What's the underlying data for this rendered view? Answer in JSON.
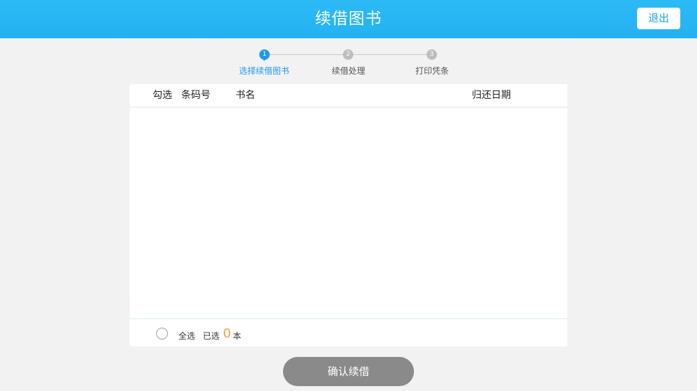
{
  "header": {
    "title": "续借图书",
    "logout_label": "退出"
  },
  "steps": [
    {
      "number": "1",
      "label": "选择续借图书",
      "active": true
    },
    {
      "number": "2",
      "label": "续借处理",
      "active": false
    },
    {
      "number": "3",
      "label": "打印凭条",
      "active": false
    }
  ],
  "table": {
    "columns": [
      "勾选",
      "条码号",
      "书名",
      "归还日期"
    ],
    "rows": []
  },
  "footer": {
    "select_all_label": "全选",
    "selected_prefix": "已选",
    "selected_count": "0",
    "selected_unit": "本"
  },
  "confirm_label": "确认续借",
  "colors": {
    "header": "#29b6f6",
    "active_step": "#2196f3",
    "count_accent": "#f7a13b",
    "confirm_button": "#8a8a8a"
  }
}
